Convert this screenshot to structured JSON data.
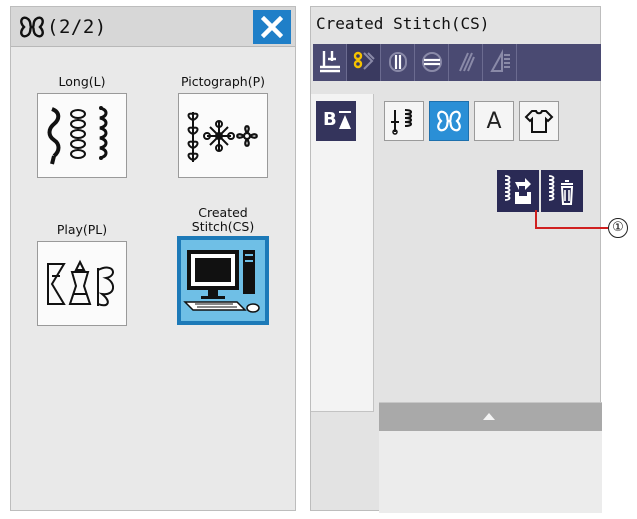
{
  "left_panel": {
    "page_indicator": "(2/2)",
    "mode_icon": "decorative-stitch-icon",
    "close_icon": "close-icon",
    "accent_color": "#1f7fc8",
    "categories": [
      {
        "label": "Long(L)",
        "icon": "long-stitch-icon",
        "selected": false
      },
      {
        "label": "Pictograph(P)",
        "icon": "pictograph-stitch-icon",
        "selected": false
      },
      {
        "label": "Play(PL)",
        "icon": "play-stitch-icon",
        "selected": false
      },
      {
        "label": "Created\nStitch(CS)",
        "icon": "computer-icon",
        "selected": true
      }
    ]
  },
  "right_panel": {
    "title": "Created Stitch(CS)",
    "toolbar_tools": [
      "utility-stitch-icon",
      "decorative-stitch-icon",
      "buttonhole-icon",
      "satin-stitch-icon",
      "quilt-stitch-icon",
      "applique-stitch-icon"
    ],
    "toolbar_active_index": 1,
    "mode_toggle_label": "B",
    "mode_toggle_icon": "arrow-down-icon",
    "type_buttons": [
      {
        "icon": "stitch-pattern-icon",
        "glyph": "",
        "selected": false
      },
      {
        "icon": "decorative-stitch-icon",
        "glyph": "",
        "selected": true
      },
      {
        "icon": "alphabet-icon",
        "glyph": "A",
        "selected": false
      },
      {
        "icon": "shirt-icon",
        "glyph": "",
        "selected": false
      }
    ],
    "cs_buttons": [
      {
        "icon": "open-stitch-file-icon"
      },
      {
        "icon": "delete-stitch-file-icon"
      }
    ],
    "callout_number": "①",
    "scroll_up_icon": "scroll-up-icon"
  }
}
